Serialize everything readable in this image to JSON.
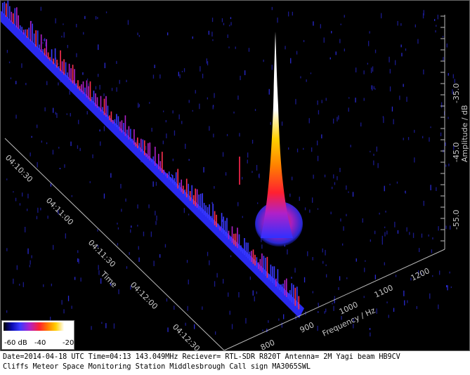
{
  "chart_data": {
    "type": "3d-waterfall",
    "time_axis": {
      "label": "Time",
      "ticks": [
        "04:10:30",
        "04:11:00",
        "04:11:30",
        "04:12:00",
        "04:12:30"
      ]
    },
    "frequency_axis": {
      "label": "Frequency / Hz",
      "ticks": [
        800,
        900,
        1000,
        1100,
        1200
      ]
    },
    "amplitude_axis": {
      "label": "Amplitude / dB",
      "ticks": [
        -55.0,
        -45.0,
        -35.0
      ],
      "tick_labels": [
        "-55.0",
        "-45.0",
        "-35.0"
      ]
    },
    "colorbar": {
      "tick_labels": [
        "-60 dB",
        "-40",
        "-20"
      ]
    },
    "features": [
      {
        "name": "carrier trace",
        "kind": "diagonal line"
      },
      {
        "name": "meteor echo",
        "peak_frequency_hz": 1000,
        "peak_amplitude_db": -31
      }
    ]
  },
  "footer": {
    "line1": "Date=2014-04-18 UTC Time=04:13 143.049MHz Reciever= RTL-SDR R820T Antenna= 2M Yagi beam HB9CV",
    "line2": "Cliffs Meteor Space Monitoring Station Middlesbrough Call sign MA3065SWL"
  }
}
